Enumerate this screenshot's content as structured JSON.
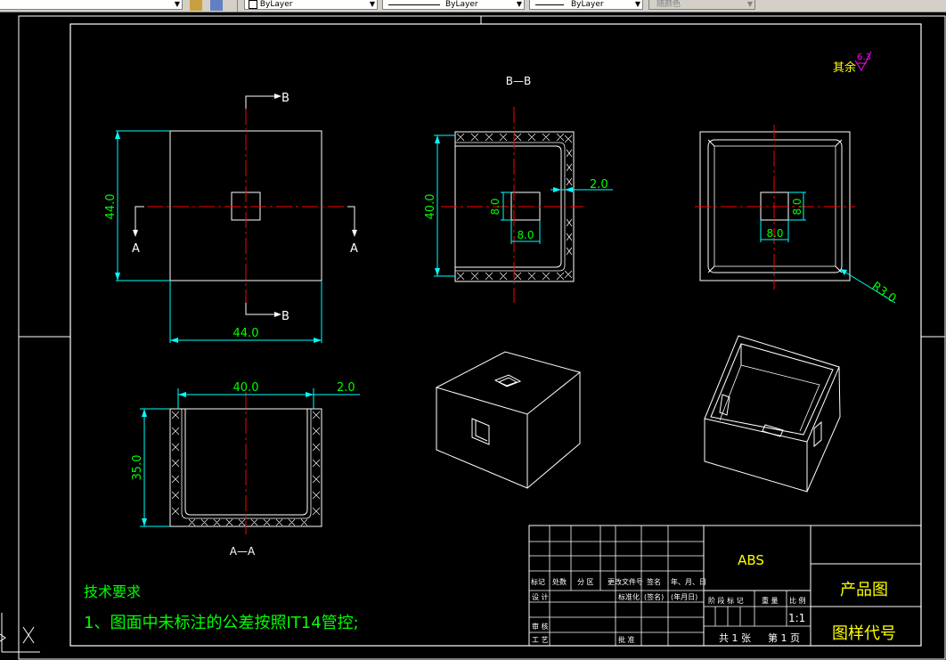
{
  "toolbar": {
    "layer_label": "ByLayer",
    "linetype_label": "ByLayer",
    "lineweight_label": "ByLayer",
    "color_label": "随颜色"
  },
  "drawing": {
    "section_bb_title": "B—B",
    "section_aa_title": "A—A",
    "surface_note": "其余",
    "surface_value": "6.3",
    "cut_label_a": "A",
    "cut_label_b": "B",
    "dims": {
      "front_height": "44.0",
      "front_width": "44.0",
      "bb_height": "40.0",
      "bb_wall": "2.0",
      "bb_hole_h": "8.0",
      "bb_hole_w": "8.0",
      "side_hole_h": "8.0",
      "side_hole_w": "8.0",
      "radius": "R3.0",
      "aa_width": "40.0",
      "aa_wall": "2.0",
      "aa_height": "35.0"
    },
    "tech_title": "技术要求",
    "tech_item": "1、图面中未标注的公差按照IT14管控;"
  },
  "title_block": {
    "material": "ABS",
    "product": "产品图",
    "drawing_code": "图样代号",
    "scale": "1:1",
    "headers": [
      "标记",
      "处数",
      "分 区",
      "更改文件号",
      "签名",
      "年、月、日"
    ],
    "row_design": "设 计",
    "row_std": "标准化",
    "row_sign": "(签名)",
    "row_date": "(年月日)",
    "row_check": "审 核",
    "row_process": "工 艺",
    "row_approve": "批 准",
    "stage_labels": [
      "阶 段 标 记",
      "重 量",
      "比 例"
    ],
    "sheets_total": "共 1 张",
    "sheet_no": "第 1 页"
  }
}
